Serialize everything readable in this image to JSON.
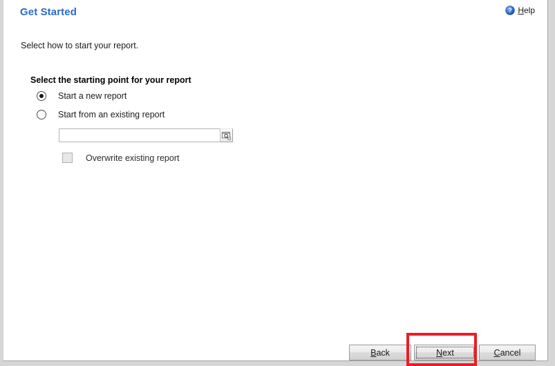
{
  "window": {
    "title": "Get Started"
  },
  "header": {
    "title": "Get Started",
    "help": {
      "label_accel": "H",
      "label_rest": "elp",
      "icon": "help-circle-icon",
      "icon_color": "#2a6bc6"
    }
  },
  "main": {
    "intro_text": "Select how to start your report.",
    "section_heading": "Select the starting point for your report",
    "options": [
      {
        "label": "Start a new report",
        "selected": true
      },
      {
        "label": "Start from an existing report",
        "selected": false
      }
    ],
    "existing_report_field": {
      "value": "",
      "placeholder": "",
      "browse_icon": "search-browse-icon"
    },
    "overwrite_checkbox": {
      "label": "Overwrite existing report",
      "checked": false,
      "enabled": false
    }
  },
  "footer": {
    "buttons": [
      {
        "accel": "B",
        "rest": "ack",
        "name": "back",
        "focused": false
      },
      {
        "accel": "N",
        "rest": "ext",
        "name": "next",
        "focused": true
      },
      {
        "accel": "C",
        "rest": "ancel",
        "name": "cancel",
        "focused": false
      }
    ]
  },
  "annotation": {
    "target": "next-button",
    "color": "#ed1c24"
  },
  "colors": {
    "title_blue": "#2a6bc6",
    "text": "#1a1a1a",
    "annotation_red": "#ed1c24",
    "window_bg": "#ffffff",
    "desktop_bg": "#d6d6d6"
  }
}
